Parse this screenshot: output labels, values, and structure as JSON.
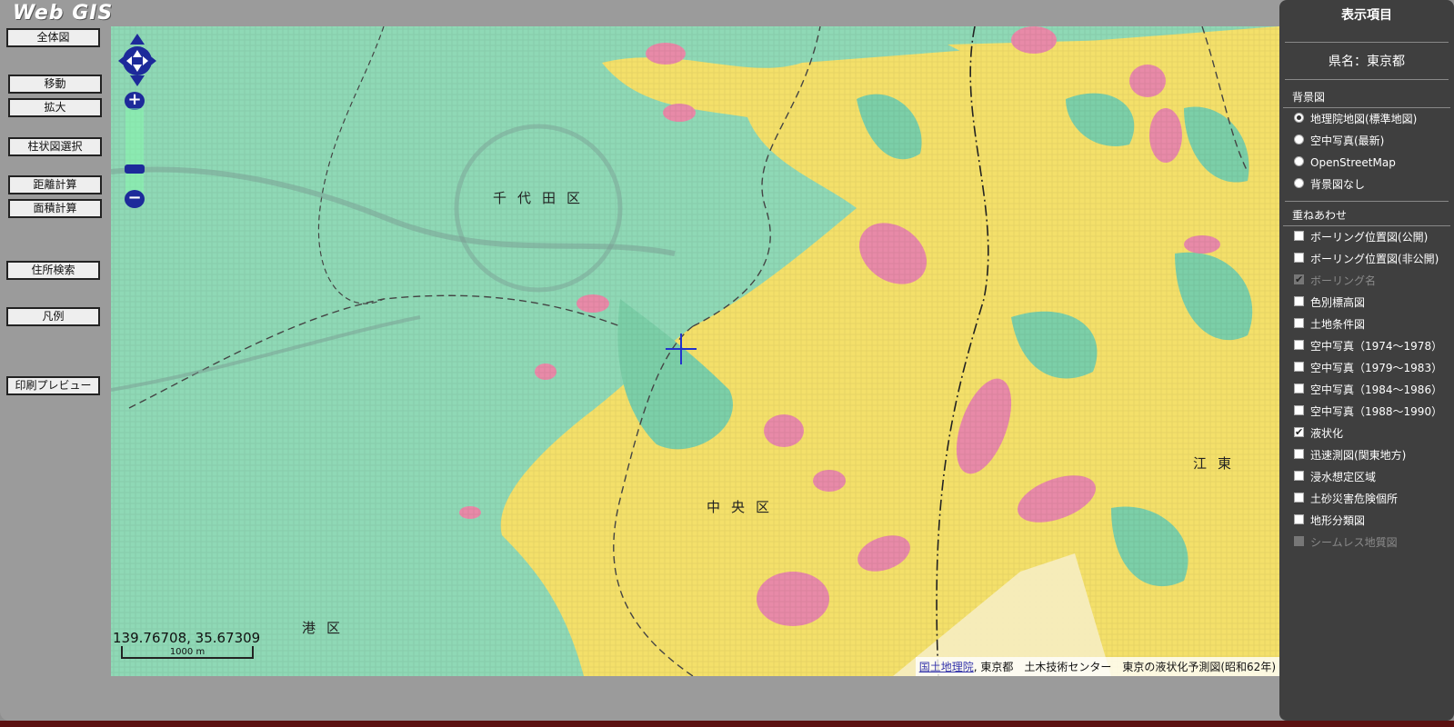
{
  "app": {
    "title": "Web GIS"
  },
  "tools": [
    {
      "id": "overview",
      "label": "全体図"
    },
    {
      "id": "move",
      "label": "移動"
    },
    {
      "id": "zoomin",
      "label": "拡大"
    },
    {
      "id": "column",
      "label": "柱状図選択"
    },
    {
      "id": "distance",
      "label": "距離計算"
    },
    {
      "id": "area",
      "label": "面積計算"
    },
    {
      "id": "address",
      "label": "住所検索"
    },
    {
      "id": "legend",
      "label": "凡例"
    },
    {
      "id": "print",
      "label": "印刷プレビュー"
    }
  ],
  "map": {
    "labels": {
      "chiyoda": "千代田区",
      "chuo": "中央区",
      "minato": "港区",
      "koto": "江東"
    },
    "coordinates": "139.76708, 35.67309",
    "scale": "1000 m",
    "attribution": {
      "link": "国土地理院",
      "text": ", 東京都　土木技術センター　東京の液状化予測図(昭和62年)"
    },
    "zoom_level_fraction": 0.75
  },
  "panel": {
    "title": "表示項目",
    "prefecture": "県名：東京都",
    "background_head": "背景図",
    "background_options": [
      {
        "label": "地理院地図(標準地図)",
        "selected": true
      },
      {
        "label": "空中写真(最新)",
        "selected": false
      },
      {
        "label": "OpenStreetMap",
        "selected": false
      },
      {
        "label": "背景図なし",
        "selected": false
      }
    ],
    "overlay_head": "重ねあわせ",
    "overlay_options": [
      {
        "label": "ボーリング位置図(公開)",
        "checked": false,
        "disabled": false
      },
      {
        "label": "ボーリング位置図(非公開)",
        "checked": false,
        "disabled": false
      },
      {
        "label": "ボーリング名",
        "checked": true,
        "disabled": true
      },
      {
        "label": "色別標高図",
        "checked": false,
        "disabled": false
      },
      {
        "label": "土地条件図",
        "checked": false,
        "disabled": false
      },
      {
        "label": "空中写真（1974～1978）",
        "checked": false,
        "disabled": false
      },
      {
        "label": "空中写真（1979～1983）",
        "checked": false,
        "disabled": false
      },
      {
        "label": "空中写真（1984～1986）",
        "checked": false,
        "disabled": false
      },
      {
        "label": "空中写真（1988～1990）",
        "checked": false,
        "disabled": false
      },
      {
        "label": "液状化",
        "checked": true,
        "disabled": false
      },
      {
        "label": "迅速測図(関東地方)",
        "checked": false,
        "disabled": false
      },
      {
        "label": "浸水想定区域",
        "checked": false,
        "disabled": false
      },
      {
        "label": "土砂災害危険個所",
        "checked": false,
        "disabled": false
      },
      {
        "label": "地形分類図",
        "checked": false,
        "disabled": false
      },
      {
        "label": "シームレス地質図",
        "checked": false,
        "disabled": true
      }
    ]
  },
  "colors": {
    "liquefaction_low": "#8fd9b6",
    "liquefaction_mid": "#f4e06a",
    "liquefaction_high": "#e88aa8",
    "panel_bg": "#3f3f3f",
    "nav_control": "#1d2a9a"
  }
}
